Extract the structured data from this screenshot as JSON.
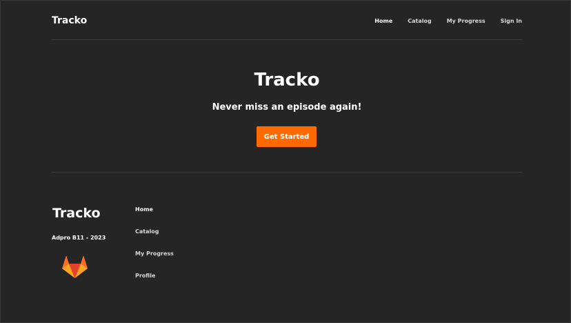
{
  "nav": {
    "brand": "Tracko",
    "links": [
      {
        "label": "Home"
      },
      {
        "label": "Catalog"
      },
      {
        "label": "My Progress"
      },
      {
        "label": "Sign In"
      }
    ]
  },
  "hero": {
    "title": "Tracko",
    "tagline": "Never miss an episode again!",
    "cta_label": "Get Started"
  },
  "footer": {
    "brand": "Tracko",
    "credit": "Adpro B11 - 2023",
    "logo_icon": "gitlab-icon",
    "links": [
      {
        "label": "Home"
      },
      {
        "label": "Catalog"
      },
      {
        "label": "My Progress"
      },
      {
        "label": "Profile"
      }
    ]
  },
  "colors": {
    "background": "#252525",
    "accent": "#ff6a00",
    "divider": "#3a3a3a",
    "text": "#ffffff"
  }
}
